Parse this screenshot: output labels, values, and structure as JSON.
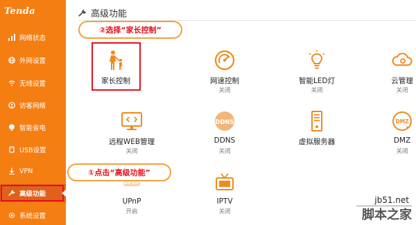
{
  "brand": {
    "logo": "Tenda"
  },
  "sidebar": {
    "items": [
      {
        "label": "网络状态",
        "icon": "chart-icon"
      },
      {
        "label": "外网设置",
        "icon": "globe-icon"
      },
      {
        "label": "无线设置",
        "icon": "wifi-icon"
      },
      {
        "label": "访客网络",
        "icon": "guest-icon"
      },
      {
        "label": "智能省电",
        "icon": "power-save-icon"
      },
      {
        "label": "USB设置",
        "icon": "usb-icon"
      },
      {
        "label": "VPN",
        "icon": "vpn-icon"
      },
      {
        "label": "高级功能",
        "icon": "wrench-icon",
        "active": true
      },
      {
        "label": "系统设置",
        "icon": "gear-icon"
      }
    ]
  },
  "main": {
    "title": "高级功能",
    "tiles": [
      {
        "label": "家长控制",
        "status": "",
        "icon": "parental-control-icon"
      },
      {
        "label": "网速控制",
        "status": "关闭",
        "icon": "speed-control-icon"
      },
      {
        "label": "智能LED灯",
        "status": "关闭",
        "icon": "led-light-icon"
      },
      {
        "label": "云管理",
        "status": "关闭",
        "icon": "cloud-manage-icon"
      },
      {
        "label": "远程WEB管理",
        "status": "关闭",
        "icon": "remote-web-icon"
      },
      {
        "label": "DDNS",
        "status": "关闭",
        "icon": "ddns-icon"
      },
      {
        "label": "虚拟服务器",
        "status": "",
        "icon": "virtual-server-icon"
      },
      {
        "label": "DMZ",
        "status": "关闭",
        "icon": "dmz-icon"
      },
      {
        "label": "UPnP",
        "status": "开启",
        "icon": "upnp-icon"
      },
      {
        "label": "IPTV",
        "status": "关闭",
        "icon": "iptv-icon"
      }
    ]
  },
  "annotations": {
    "step1": "①点击“高级功能”",
    "step2": "②选择“家长控制”"
  },
  "watermark": {
    "site": "jb51.net",
    "name": "脚本之家"
  },
  "colors": {
    "sidebar": "#f57e12",
    "accent": "#e2111a",
    "callout_border": "#f2a13a",
    "icon_orange": "#f08a1c"
  }
}
